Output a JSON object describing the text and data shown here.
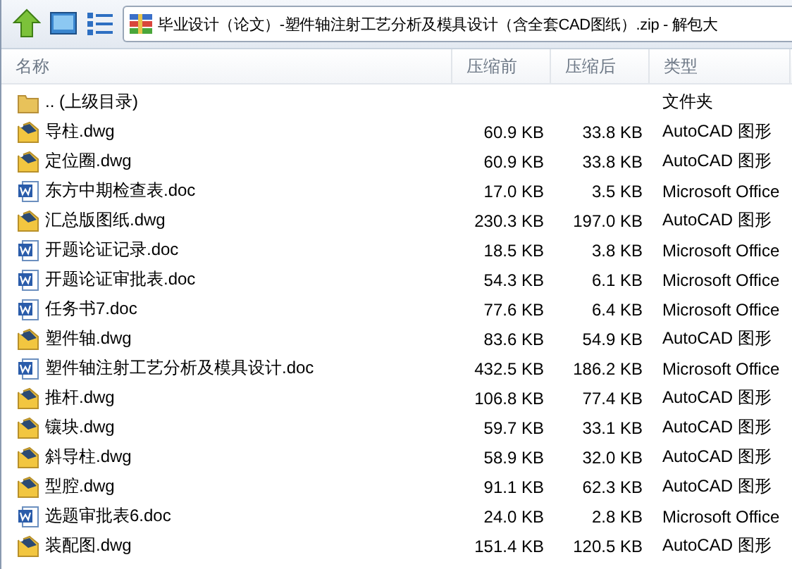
{
  "toolbar": {
    "address": "毕业设计（论文）-塑件轴注射工艺分析及模具设计（含全套CAD图纸）.zip - 解包大"
  },
  "table": {
    "columns": [
      "名称",
      "压缩前",
      "压缩后",
      "类型"
    ],
    "rows": [
      {
        "kind": "folder",
        "name": ".. (上级目录)",
        "size": "",
        "packed": "",
        "type": "文件夹"
      },
      {
        "kind": "dwg",
        "name": "导柱.dwg",
        "size": "60.9 KB",
        "packed": "33.8 KB",
        "type": "AutoCAD 图形"
      },
      {
        "kind": "dwg",
        "name": "定位圈.dwg",
        "size": "60.9 KB",
        "packed": "33.8 KB",
        "type": "AutoCAD 图形"
      },
      {
        "kind": "doc",
        "name": "东方中期检查表.doc",
        "size": "17.0 KB",
        "packed": "3.5 KB",
        "type": "Microsoft Office"
      },
      {
        "kind": "dwg",
        "name": "汇总版图纸.dwg",
        "size": "230.3 KB",
        "packed": "197.0 KB",
        "type": "AutoCAD 图形"
      },
      {
        "kind": "doc",
        "name": "开题论证记录.doc",
        "size": "18.5 KB",
        "packed": "3.8 KB",
        "type": "Microsoft Office"
      },
      {
        "kind": "doc",
        "name": "开题论证审批表.doc",
        "size": "54.3 KB",
        "packed": "6.1 KB",
        "type": "Microsoft Office"
      },
      {
        "kind": "doc",
        "name": "任务书7.doc",
        "size": "77.6 KB",
        "packed": "6.4 KB",
        "type": "Microsoft Office"
      },
      {
        "kind": "dwg",
        "name": "塑件轴.dwg",
        "size": "83.6 KB",
        "packed": "54.9 KB",
        "type": "AutoCAD 图形"
      },
      {
        "kind": "doc",
        "name": "塑件轴注射工艺分析及模具设计.doc",
        "size": "432.5 KB",
        "packed": "186.2 KB",
        "type": "Microsoft Office"
      },
      {
        "kind": "dwg",
        "name": "推杆.dwg",
        "size": "106.8 KB",
        "packed": "77.4 KB",
        "type": "AutoCAD 图形"
      },
      {
        "kind": "dwg",
        "name": "镶块.dwg",
        "size": "59.7 KB",
        "packed": "33.1 KB",
        "type": "AutoCAD 图形"
      },
      {
        "kind": "dwg",
        "name": "斜导柱.dwg",
        "size": "58.9 KB",
        "packed": "32.0 KB",
        "type": "AutoCAD 图形"
      },
      {
        "kind": "dwg",
        "name": "型腔.dwg",
        "size": "91.1 KB",
        "packed": "62.3 KB",
        "type": "AutoCAD 图形"
      },
      {
        "kind": "doc",
        "name": "选题审批表6.doc",
        "size": "24.0 KB",
        "packed": "2.8 KB",
        "type": "Microsoft Office"
      },
      {
        "kind": "dwg",
        "name": "装配图.dwg",
        "size": "151.4 KB",
        "packed": "120.5 KB",
        "type": "AutoCAD 图形"
      }
    ]
  }
}
